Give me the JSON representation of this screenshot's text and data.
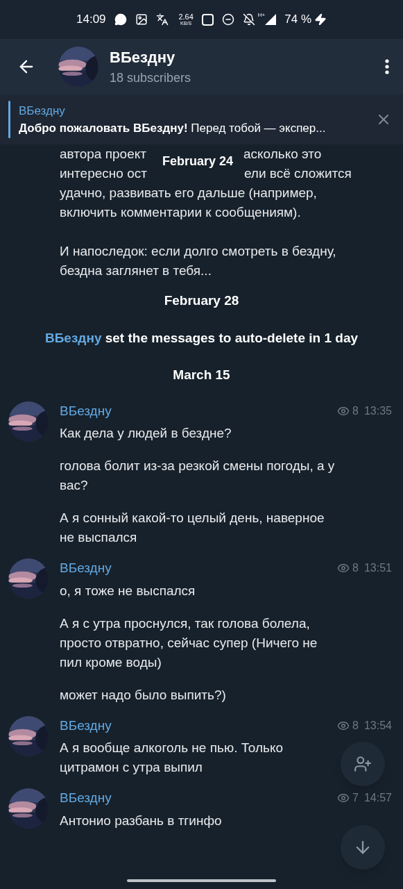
{
  "status_bar": {
    "time": "14:09",
    "speed": "2.64",
    "speed_unit": "KB/S",
    "network": "H+",
    "battery": "74 %"
  },
  "header": {
    "title": "ВБездну",
    "subtitle": "18 subscribers"
  },
  "pinned": {
    "title": "ВБездну",
    "bold": "Добро пожаловать ВБездну!",
    "text": "Перед тобой — экспер..."
  },
  "top_message": {
    "split_lines": [
      [
        "автора проект",
        "асколько это"
      ],
      [
        "интересно ост",
        "ели всё сложится"
      ]
    ],
    "lines": [
      "удачно, развивать его дальше (например, включить комментарии к сообщениям).",
      "И напоследок: если долго смотреть в бездну, бездна заглянет в тебя..."
    ]
  },
  "floating_date": "February 24",
  "feed": [
    {
      "kind": "date",
      "text": "February 28"
    },
    {
      "kind": "service",
      "actor": "ВБездну",
      "text": "set the messages to auto-delete in 1 day"
    },
    {
      "kind": "date",
      "text": "March 15"
    },
    {
      "kind": "message",
      "author": "ВБездну",
      "views": "8",
      "time": "13:35",
      "paragraphs": [
        "Как дела у людей в бездне?",
        "голова болит из-за резкой смены погоды, а у вас?",
        "А я сонный какой-то целый день, наверное не выспался"
      ]
    },
    {
      "kind": "message",
      "author": "ВБездну",
      "views": "8",
      "time": "13:51",
      "paragraphs": [
        "о, я тоже не выспался",
        "А я с утра проснулся, так голова болела, просто отвратно, сейчас супер (Ничего не пил кроме воды)",
        "может надо было выпить?)"
      ]
    },
    {
      "kind": "message",
      "author": "ВБездну",
      "views": "8",
      "time": "13:54",
      "paragraphs": [
        "А я вообще алкоголь не пью. Только цитрамон с утра выпил"
      ]
    },
    {
      "kind": "message",
      "author": "ВБездну",
      "views": "7",
      "time": "14:57",
      "paragraphs": [
        "Антонио разбань в тгинфо"
      ]
    }
  ]
}
